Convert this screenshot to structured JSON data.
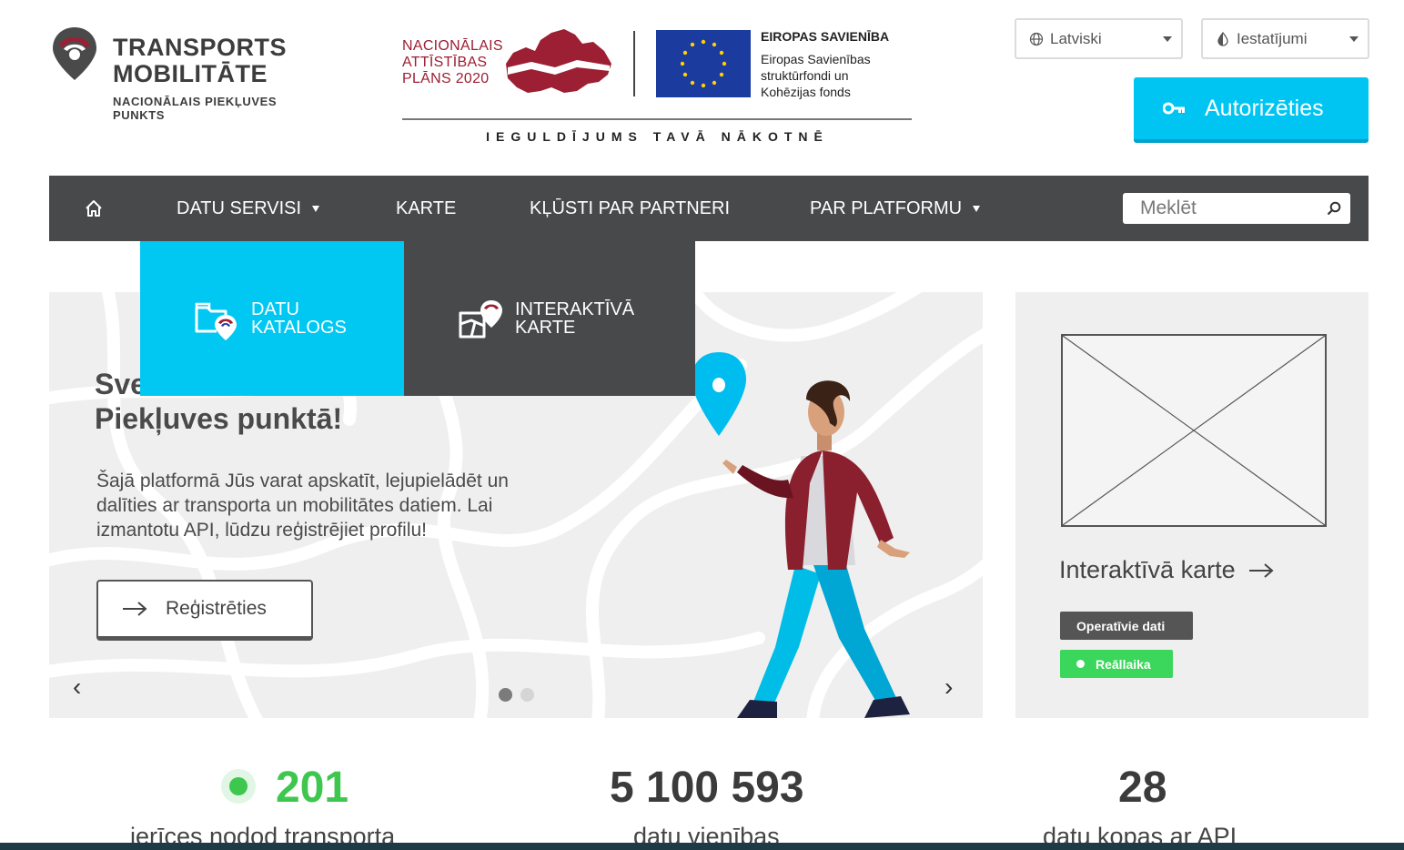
{
  "logo": {
    "title_line1": "TRANSPORTS",
    "title_line2": "MOBILITĀTE",
    "subtitle_line1": "NACIONĀLAIS PIEKĻUVES",
    "subtitle_line2": "PUNKTS"
  },
  "eu_banner": {
    "nap_line1": "NACIONĀLAIS",
    "nap_line2": "ATTĪSTĪBAS",
    "nap_line3": "PLĀNS 2020",
    "eu_title": "EIROPAS SAVIENĪBA",
    "eu_line1": "Eiropas Savienības",
    "eu_line2": "struktūrfondi un",
    "eu_line3": "Kohēzijas fonds",
    "slogan": "IEGULDĪJUMS TAVĀ NĀKOTNĒ"
  },
  "header": {
    "language": "Latviski",
    "settings": "Iestatījumi",
    "auth_label": "Autorizēties"
  },
  "nav": {
    "items": [
      {
        "label": "DATU SERVISI"
      },
      {
        "label": "KARTE"
      },
      {
        "label": "KĻŪSTI PAR PARTNERI"
      },
      {
        "label": "PAR PLATFORMU"
      }
    ],
    "search_placeholder": "Meklēt"
  },
  "dropdown": {
    "catalog_line1": "DATU",
    "catalog_line2": "KATALOGS",
    "map_line1": "INTERAKTĪVĀ",
    "map_line2": "KARTE"
  },
  "hero": {
    "heading_line1": "Sve",
    "heading_line2": "Piekļuves punktā!",
    "text_line1": "Šajā platformā Jūs varat apskatīt, lejupielādēt un",
    "text_line2": "dalīties ar transporta un mobilitātes datiem. Lai",
    "text_line3": "izmantotu API, lūdzu reģistrējiet profilu!",
    "register_label": "Reģistrēties",
    "prev": "‹",
    "next": "›"
  },
  "side_card": {
    "title": "Interaktīvā karte",
    "badge_operational": "Operatīvie dati",
    "badge_realtime": "Reāllaika"
  },
  "stats": [
    {
      "value": "201",
      "label": "ierīces nodod transporta"
    },
    {
      "value": "5 100 593",
      "label": "datu vienības"
    },
    {
      "value": "28",
      "label": "datu kopas ar API"
    }
  ],
  "colors": {
    "accent": "#00c5f2",
    "nav": "#48494b",
    "brand_red": "#9c1f33",
    "live": "#3ec74f"
  }
}
